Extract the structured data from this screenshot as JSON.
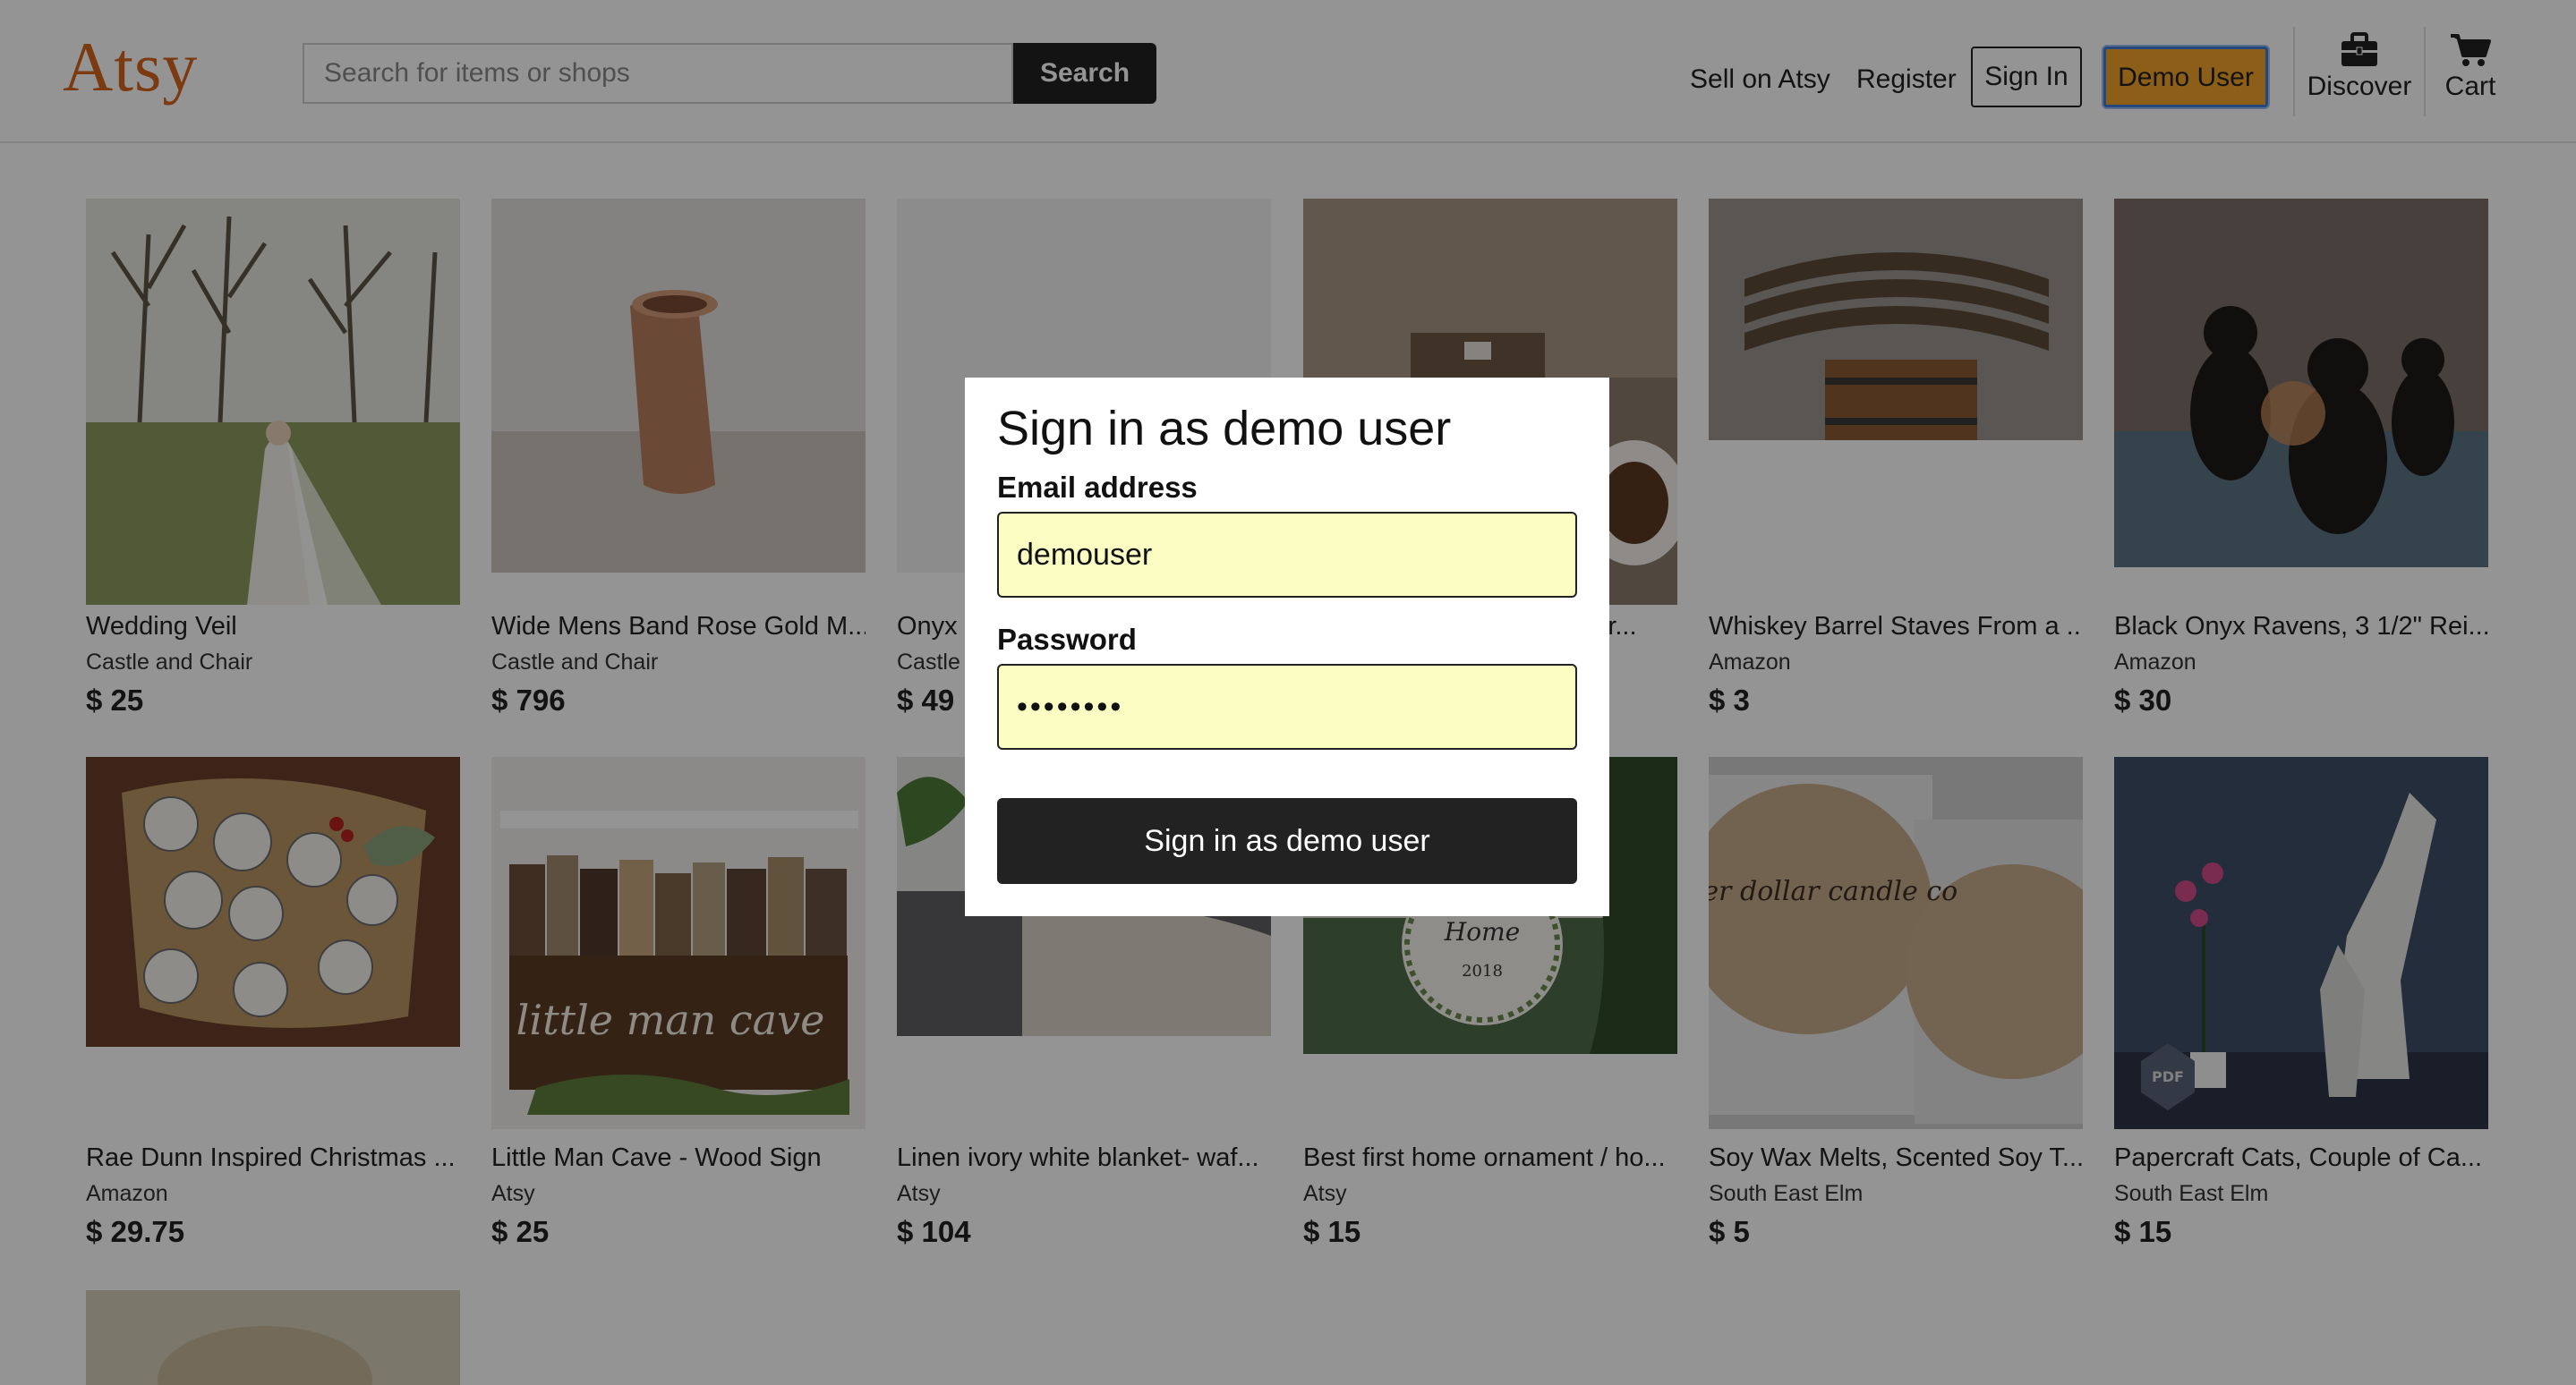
{
  "header": {
    "logo": "Atsy",
    "search_placeholder": "Search for items or shops",
    "search_button": "Search",
    "sell_link": "Sell on Atsy",
    "register_link": "Register",
    "signin_button": "Sign In",
    "demo_button": "Demo User",
    "discover_label": "Discover",
    "discover_icon": "briefcase-icon",
    "cart_label": "Cart",
    "cart_icon": "cart-icon",
    "demo_button_color": "#f2a32a"
  },
  "products": [
    {
      "title": "Wedding Veil",
      "shop": "Castle and Chair",
      "price": "$ 25"
    },
    {
      "title": "Wide Mens Band Rose Gold M...",
      "shop": "Castle and Chair",
      "price": "$ 796"
    },
    {
      "title": "Onyx",
      "shop": "Castle",
      "price": "$ 49"
    },
    {
      "title": "od r...",
      "shop": "",
      "price": ""
    },
    {
      "title": "Whiskey Barrel Staves From a ...",
      "shop": "Amazon",
      "price": "$ 3"
    },
    {
      "title": "Black Onyx Ravens, 3 1/2\" Rei...",
      "shop": "Amazon",
      "price": "$ 30"
    },
    {
      "title": "Rae Dunn Inspired Christmas ...",
      "shop": "Amazon",
      "price": "$ 29.75"
    },
    {
      "title": "Little Man Cave - Wood Sign",
      "shop": "Atsy",
      "price": "$ 25"
    },
    {
      "title": "Linen ivory white blanket- waf...",
      "shop": "Atsy",
      "price": "$ 104"
    },
    {
      "title": "Best first home ornament / ho...",
      "shop": "Atsy",
      "price": "$ 15"
    },
    {
      "title": "Soy Wax Melts, Scented Soy T...",
      "shop": "South East Elm",
      "price": "$ 5"
    },
    {
      "title": "Papercraft Cats, Couple of Ca...",
      "shop": "South East Elm",
      "price": "$ 15"
    }
  ],
  "product_images": {
    "p2_text": "little man cave",
    "p3_text": "Home",
    "p3_sub": "2018",
    "p4_text": "silver dollar candle co",
    "p5_text": "PDF"
  },
  "modal": {
    "title": "Sign in as demo user",
    "email_label": "Email address",
    "email_value": "demouser",
    "password_label": "Password",
    "password_value": "••••••••",
    "submit_label": "Sign in as demo user",
    "field_color": "#fbfdc2"
  }
}
